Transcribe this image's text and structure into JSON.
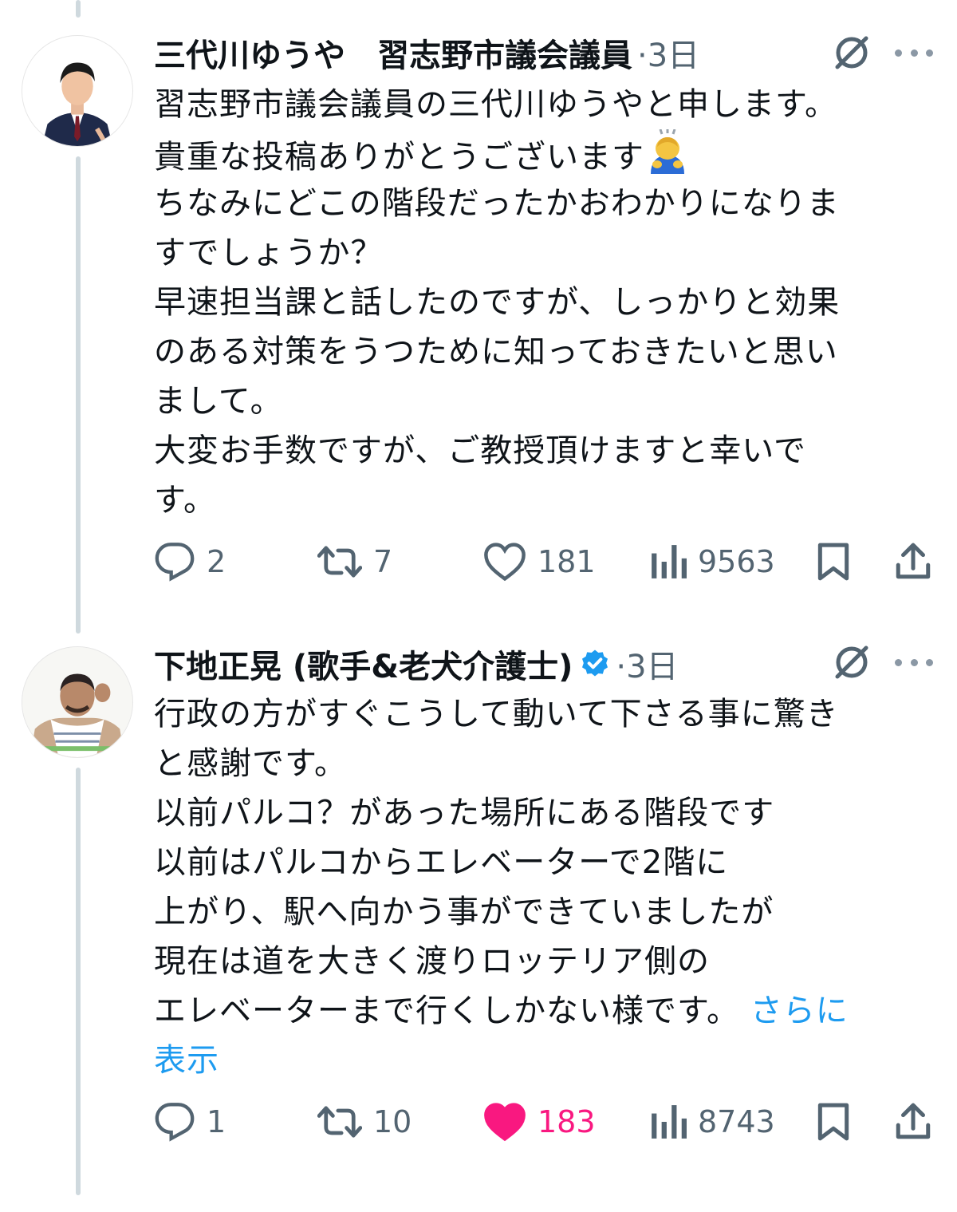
{
  "tweets": [
    {
      "author": "三代川ゆうや　習志野市議会議員",
      "time": "·3日",
      "verified": false,
      "lines": [
        "習志野市議会議員の三代川ゆうやと申します。",
        "貴重な投稿ありがとうございます",
        "ちなみにどこの階段だったかおわかりになりま",
        "すでしょうか？",
        "早速担当課と話したのですが、しっかりと効果",
        "のある対策をうつために知っておきたいと思い",
        "まして。",
        "大変お手数ですが、ご教授頂けますと幸いで",
        "す。"
      ],
      "emoji": "person-bowing-emoji",
      "replies": "2",
      "reposts": "7",
      "likes": "181",
      "views": "9563",
      "liked": false
    },
    {
      "author": "下地正晃 (歌手&老犬介護士)",
      "time": "·3日",
      "verified": true,
      "lines": [
        "行政の方がすぐこうして動いて下さる事に驚き",
        "と感謝です。",
        "以前パルコ？があった場所にある階段です",
        "以前はパルコからエレベーターで2階に",
        "上がり、駅へ向かう事ができていましたが",
        "現在は道を大きく渡りロッテリア側の",
        "エレベーターまで行くしかない様です。"
      ],
      "show_more_1": "さらに",
      "show_more_2": "表示",
      "replies": "1",
      "reposts": "10",
      "likes": "183",
      "views": "8743",
      "liked": true
    }
  ],
  "colors": {
    "text": "#0f1419",
    "secondary": "#536471",
    "link": "#1d9bf0",
    "like": "#f91880",
    "verified": "#1d9bf0",
    "thread_line": "#cfd9de"
  },
  "icons": [
    "reply-icon",
    "repost-icon",
    "like-icon",
    "views-icon",
    "bookmark-icon",
    "share-icon",
    "grok-icon",
    "more-icon",
    "verified-badge-icon"
  ]
}
